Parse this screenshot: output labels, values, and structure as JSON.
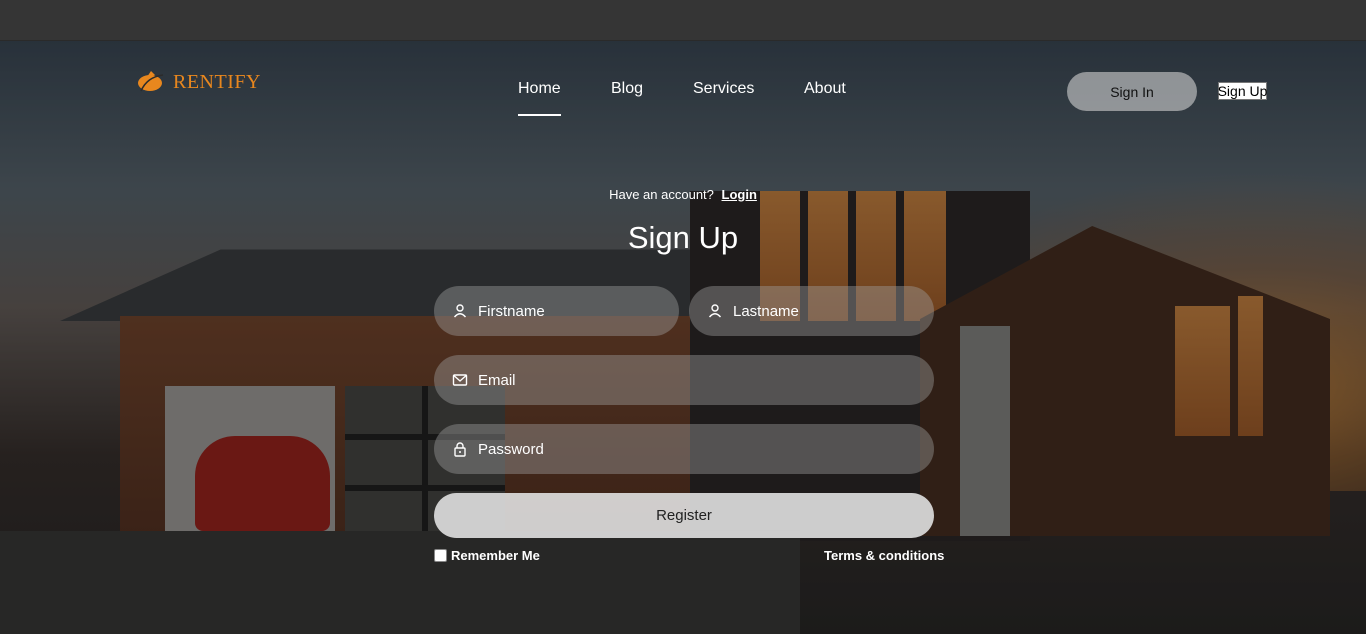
{
  "brand": {
    "name": "RENTIFY",
    "color": "#e8871e"
  },
  "nav": {
    "items": [
      {
        "label": "Home",
        "active": true
      },
      {
        "label": "Blog",
        "active": false
      },
      {
        "label": "Services",
        "active": false
      },
      {
        "label": "About",
        "active": false
      }
    ]
  },
  "auth": {
    "signin_label": "Sign In",
    "signup_label": "Sign Up"
  },
  "form": {
    "have_account_text": "Have an account?",
    "login_link": "Login",
    "title": "Sign Up",
    "fields": {
      "firstname": {
        "placeholder": "Firstname",
        "icon": "user-icon"
      },
      "lastname": {
        "placeholder": "Lastname",
        "icon": "user-icon"
      },
      "email": {
        "placeholder": "Email",
        "icon": "mail-icon"
      },
      "password": {
        "placeholder": "Password",
        "icon": "lock-icon"
      }
    },
    "register_label": "Register",
    "remember_label": "Remember Me",
    "remember_checked": false,
    "terms_label": "Terms & conditions"
  }
}
